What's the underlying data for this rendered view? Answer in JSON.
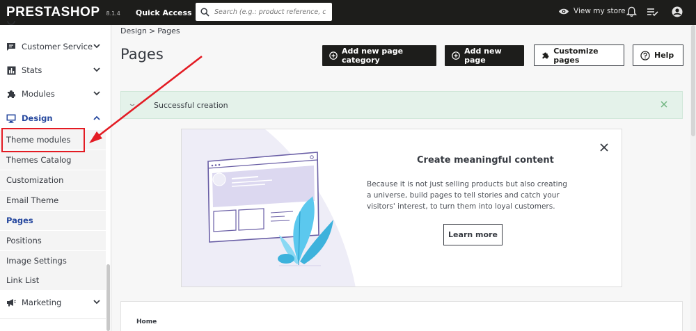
{
  "topbar": {
    "logo": "PRESTASHOP",
    "version": "8.1.4",
    "quick_access": "Quick Access",
    "search_placeholder": "Search (e.g.: product reference, custon",
    "view_store": "View my store"
  },
  "sidebar": {
    "items": [
      {
        "label": "Customer Service",
        "icon": "chat-icon"
      },
      {
        "label": "Stats",
        "icon": "bar-chart-icon"
      },
      {
        "label": "Modules",
        "icon": "puzzle-icon"
      },
      {
        "label": "Design",
        "icon": "monitor-icon"
      },
      {
        "label": "Marketing",
        "icon": "megaphone-icon"
      }
    ],
    "design_sub": [
      "Theme modules",
      "Themes Catalog",
      "Customization",
      "Email Theme",
      "Pages",
      "Positions",
      "Image Settings",
      "Link List"
    ],
    "current": "Pages"
  },
  "breadcrumb": {
    "parent": "Design",
    "separator": ">",
    "current": "Pages"
  },
  "page": {
    "title": "Pages",
    "buttons": {
      "add_category": "Add new page category",
      "add_page": "Add new page",
      "customize": "Customize pages",
      "help": "Help"
    }
  },
  "alert": {
    "message": "Successful creation",
    "color": "#e4f2ea"
  },
  "banner": {
    "title": "Create meaningful content",
    "text": "Because it is not just selling products but also creating a universe, build pages to tell stories and catch your visitors' interest, to turn them into loyal customers.",
    "button": "Learn more"
  },
  "table": {
    "breadcrumb_home": "Home"
  },
  "colors": {
    "topbar": "#1d1d1b",
    "accent": "#25479e",
    "annotation": "#e31b23"
  }
}
